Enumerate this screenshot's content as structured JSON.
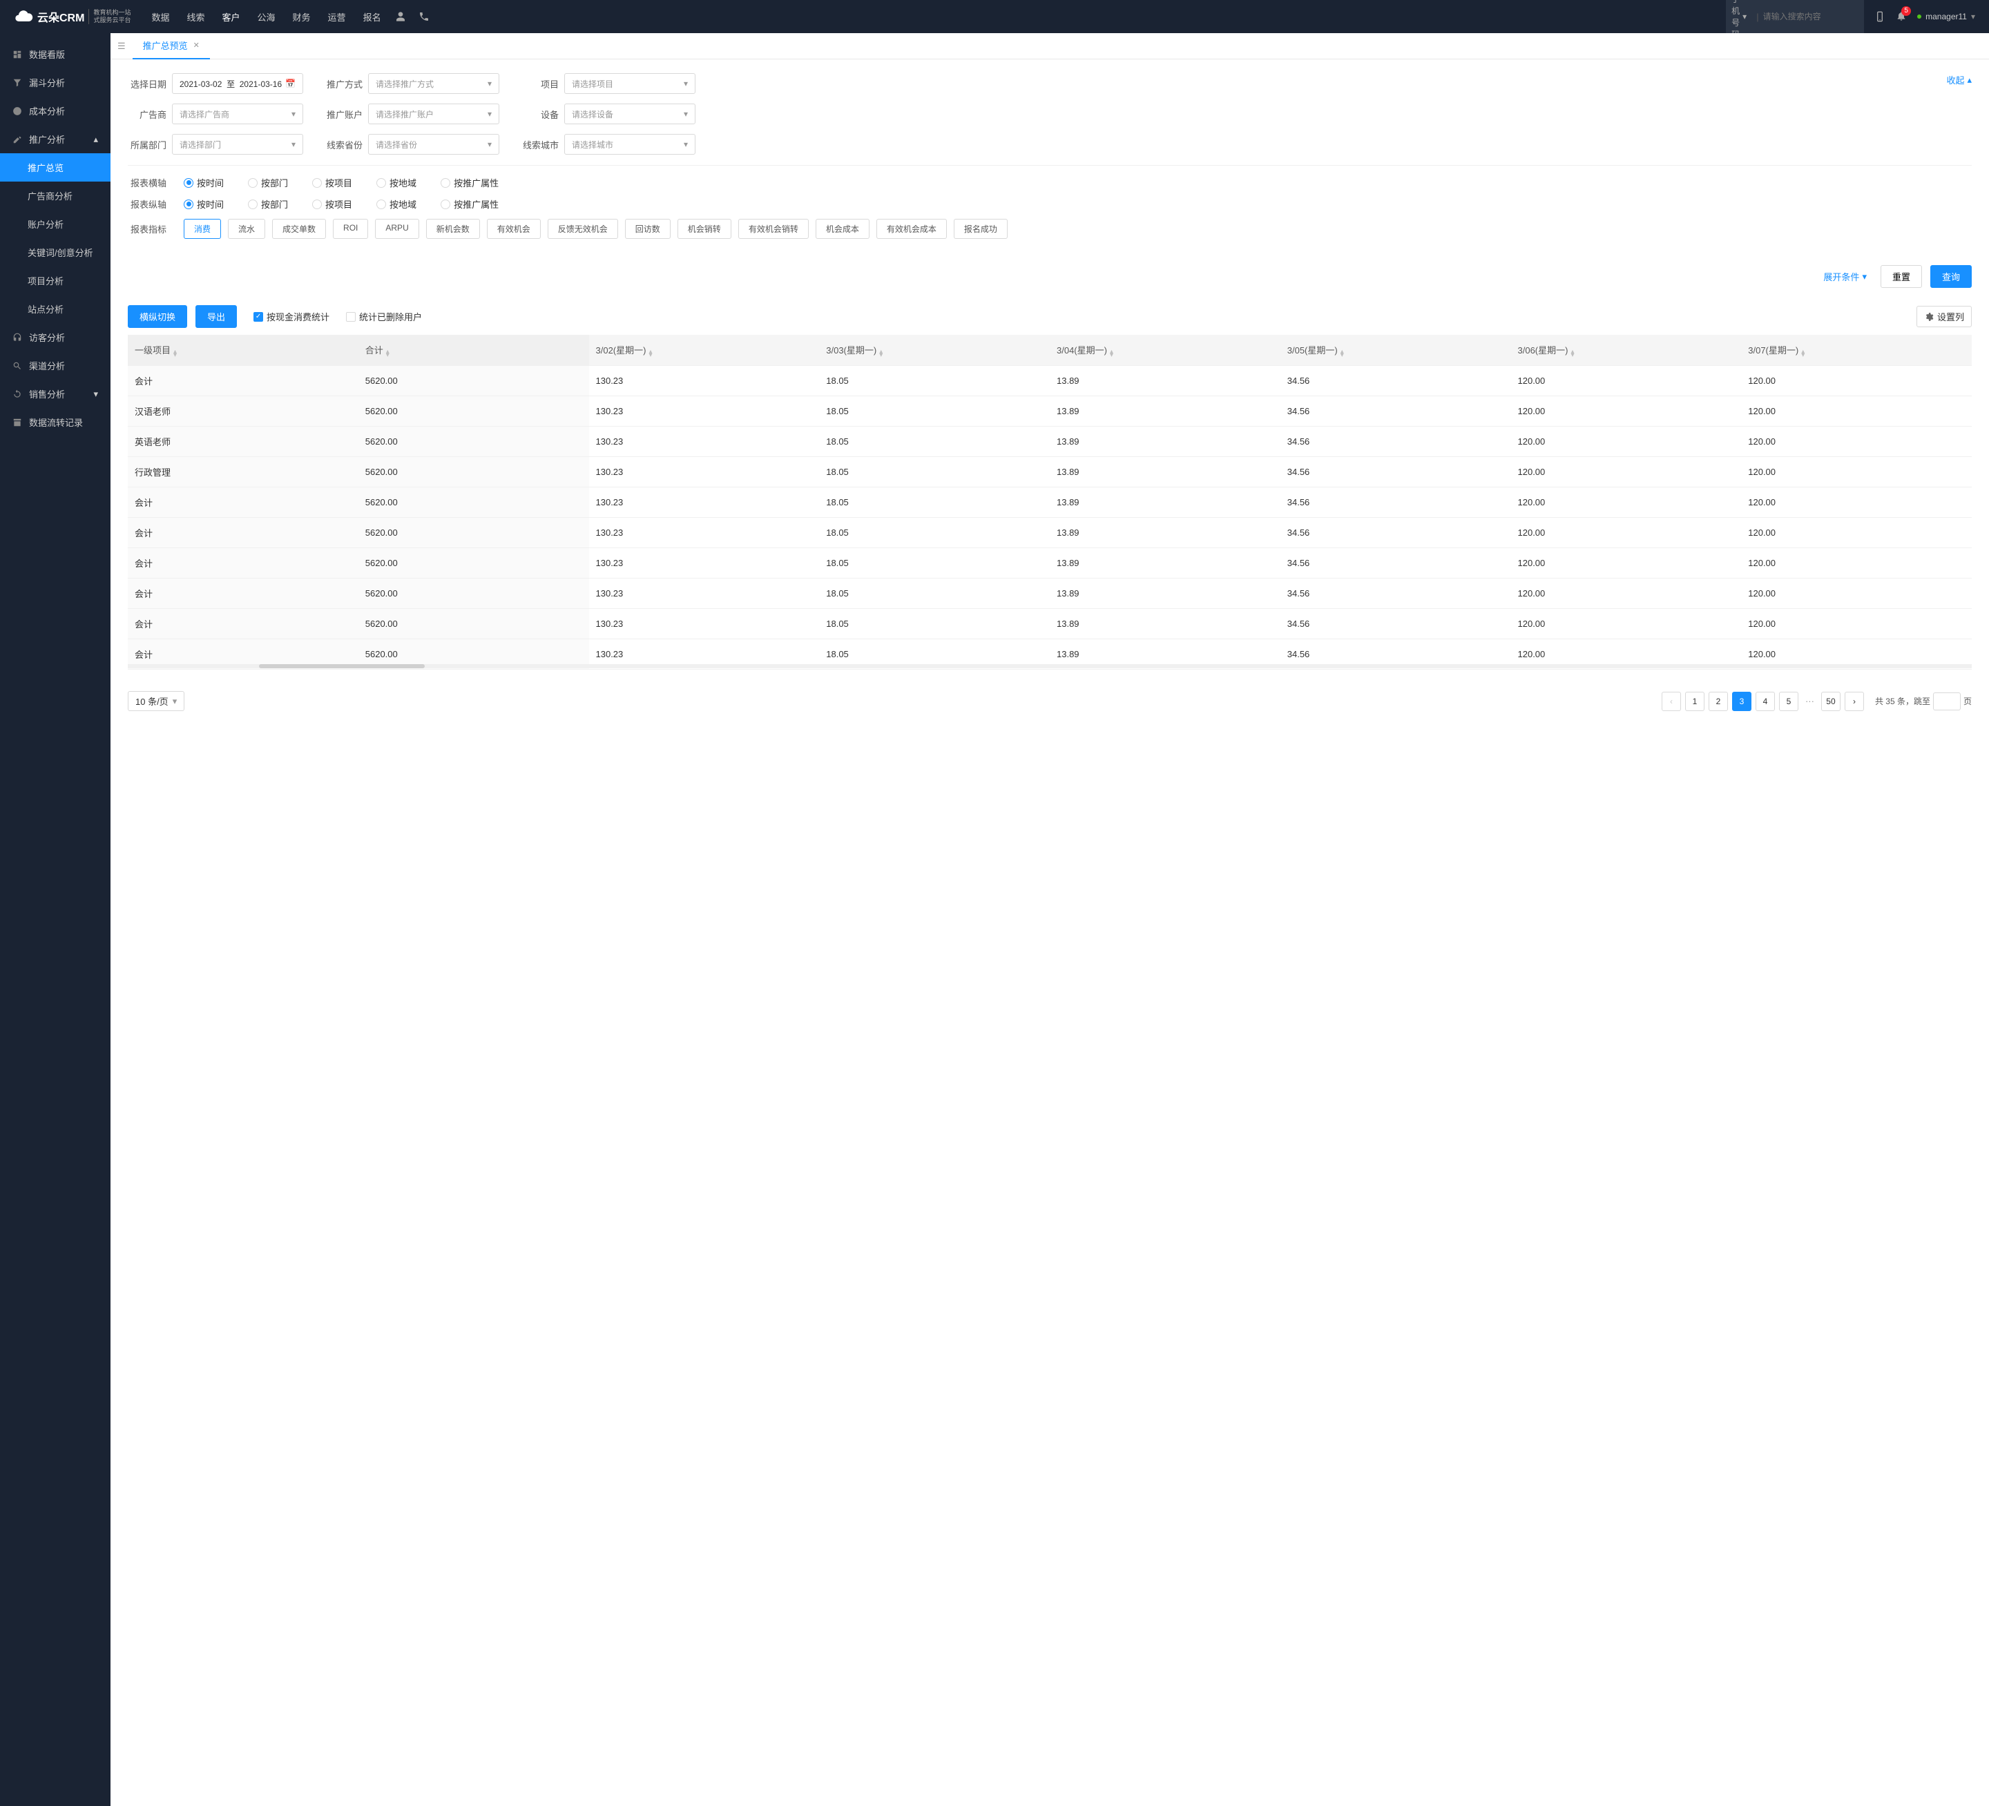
{
  "logo": {
    "name": "云朵CRM",
    "sub1": "教育机构一站",
    "sub2": "式服务云平台"
  },
  "top_nav": [
    "数据",
    "线索",
    "客户",
    "公海",
    "财务",
    "运营",
    "报名"
  ],
  "top_nav_active": 2,
  "search": {
    "type": "手机号码",
    "placeholder": "请输入搜索内容"
  },
  "badge_count": "5",
  "user": "manager11",
  "sidebar": {
    "items": [
      {
        "label": "数据看版",
        "icon": "dashboard"
      },
      {
        "label": "漏斗分析",
        "icon": "funnel"
      },
      {
        "label": "成本分析",
        "icon": "clock"
      },
      {
        "label": "推广分析",
        "icon": "edit",
        "expanded": true,
        "children": [
          {
            "label": "推广总览",
            "active": true
          },
          {
            "label": "广告商分析"
          },
          {
            "label": "账户分析"
          },
          {
            "label": "关键词/创意分析"
          },
          {
            "label": "项目分析"
          },
          {
            "label": "站点分析"
          }
        ]
      },
      {
        "label": "访客分析",
        "icon": "headset"
      },
      {
        "label": "渠道分析",
        "icon": "search"
      },
      {
        "label": "销售分析",
        "icon": "refresh",
        "collapsible": true
      },
      {
        "label": "数据流转记录",
        "icon": "archive"
      }
    ]
  },
  "tab_title": "推广总预览",
  "filters": {
    "date_label": "选择日期",
    "date_from": "2021-03-02",
    "date_sep": "至",
    "date_to": "2021-03-16",
    "promo_type_label": "推广方式",
    "promo_type_ph": "请选择推广方式",
    "project_label": "项目",
    "project_ph": "请选择项目",
    "advertiser_label": "广告商",
    "advertiser_ph": "请选择广告商",
    "promo_account_label": "推广账户",
    "promo_account_ph": "请选择推广账户",
    "device_label": "设备",
    "device_ph": "请选择设备",
    "dept_label": "所属部门",
    "dept_ph": "请选择部门",
    "province_label": "线索省份",
    "province_ph": "请选择省份",
    "city_label": "线索城市",
    "city_ph": "请选择城市"
  },
  "collapse": "收起",
  "axis": {
    "x_label": "报表横轴",
    "y_label": "报表纵轴",
    "options": [
      "按时间",
      "按部门",
      "按项目",
      "按地域",
      "按推广属性"
    ],
    "x_selected": 0,
    "y_selected": 0
  },
  "metrics_label": "报表指标",
  "metrics": [
    "消费",
    "流水",
    "成交单数",
    "ROI",
    "ARPU",
    "新机会数",
    "有效机会",
    "反馈无效机会",
    "回访数",
    "机会销转",
    "有效机会销转",
    "机会成本",
    "有效机会成本",
    "报名成功"
  ],
  "metrics_active": 0,
  "expand_conditions": "展开条件",
  "reset": "重置",
  "query": "查询",
  "toggle_axis": "横纵切换",
  "export": "导出",
  "chk_cash": "按现金消费统计",
  "chk_deleted": "统计已删除用户",
  "col_settings": "设置列",
  "table": {
    "headers": [
      "一级项目",
      "合计",
      "3/02(星期一)",
      "3/03(星期一)",
      "3/04(星期一)",
      "3/05(星期一)",
      "3/06(星期一)",
      "3/07(星期一)"
    ],
    "rows": [
      [
        "会计",
        "5620.00",
        "130.23",
        "18.05",
        "13.89",
        "34.56",
        "120.00",
        "120.00"
      ],
      [
        "汉语老师",
        "5620.00",
        "130.23",
        "18.05",
        "13.89",
        "34.56",
        "120.00",
        "120.00"
      ],
      [
        "英语老师",
        "5620.00",
        "130.23",
        "18.05",
        "13.89",
        "34.56",
        "120.00",
        "120.00"
      ],
      [
        "行政管理",
        "5620.00",
        "130.23",
        "18.05",
        "13.89",
        "34.56",
        "120.00",
        "120.00"
      ],
      [
        "会计",
        "5620.00",
        "130.23",
        "18.05",
        "13.89",
        "34.56",
        "120.00",
        "120.00"
      ],
      [
        "会计",
        "5620.00",
        "130.23",
        "18.05",
        "13.89",
        "34.56",
        "120.00",
        "120.00"
      ],
      [
        "会计",
        "5620.00",
        "130.23",
        "18.05",
        "13.89",
        "34.56",
        "120.00",
        "120.00"
      ],
      [
        "会计",
        "5620.00",
        "130.23",
        "18.05",
        "13.89",
        "34.56",
        "120.00",
        "120.00"
      ],
      [
        "会计",
        "5620.00",
        "130.23",
        "18.05",
        "13.89",
        "34.56",
        "120.00",
        "120.00"
      ],
      [
        "会计",
        "5620.00",
        "130.23",
        "18.05",
        "13.89",
        "34.56",
        "120.00",
        "120.00"
      ]
    ]
  },
  "pagination": {
    "page_size": "10 条/页",
    "pages": [
      "1",
      "2",
      "3",
      "4",
      "5"
    ],
    "last": "50",
    "active": 2,
    "total_prefix": "共 35 条，",
    "jump_prefix": "跳至",
    "jump_suffix": "页"
  }
}
